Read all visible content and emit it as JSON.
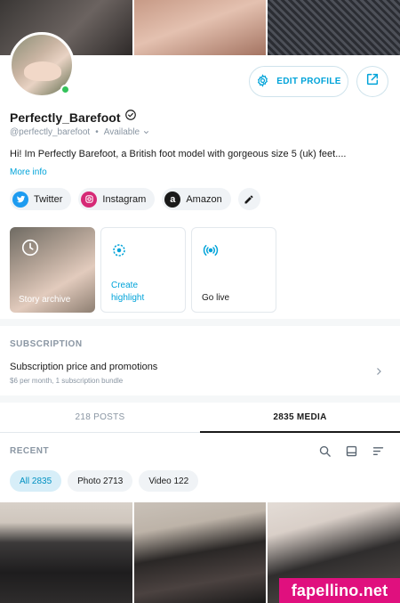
{
  "profile": {
    "name": "Perfectly_Barefoot",
    "handle": "@perfectly_barefoot",
    "availability": "Available",
    "bio": "Hi! Im Perfectly Barefoot, a British foot model with gorgeous size 5 (uk) feet....",
    "more_info": "More info"
  },
  "actions": {
    "edit_profile": "EDIT PROFILE"
  },
  "socials": [
    {
      "label": "Twitter",
      "color": "#1d9bf0"
    },
    {
      "label": "Instagram",
      "color": "#d62976"
    },
    {
      "label": "Amazon",
      "color": "#1a1a1a"
    }
  ],
  "cards": {
    "story_archive": "Story archive",
    "create_highlight_1": "Create",
    "create_highlight_2": "highlight",
    "go_live": "Go live"
  },
  "subscription": {
    "title": "SUBSCRIPTION",
    "main": "Subscription price and promotions",
    "sub": "$6 per month, 1 subscription bundle"
  },
  "tabs": [
    {
      "label": "218 POSTS",
      "active": false
    },
    {
      "label": "2835 MEDIA",
      "active": true
    }
  ],
  "recent": {
    "title": "RECENT",
    "filters": [
      {
        "label": "All 2835",
        "active": true
      },
      {
        "label": "Photo 2713",
        "active": false
      },
      {
        "label": "Video 122",
        "active": false
      }
    ]
  },
  "watermark": "fapellino.net",
  "colors": {
    "accent": "#00a3d9",
    "online": "#33c25a",
    "watermark": "#e0107e"
  }
}
